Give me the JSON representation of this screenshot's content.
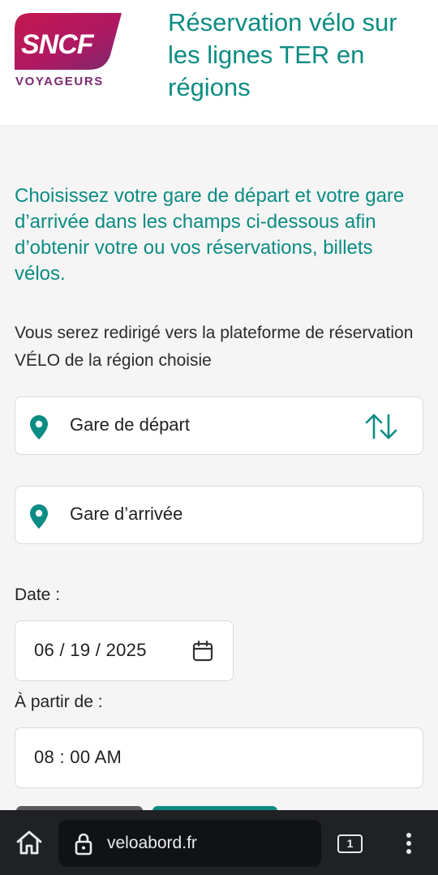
{
  "header": {
    "logo_text": "SNCF",
    "logo_sub": "VOYAGEURS",
    "title": "Réservation vélo sur les lignes TER en régions"
  },
  "main": {
    "intro": "Choisissez votre gare de départ et votre gare d’arrivée dans les champs ci-dessous afin d’obtenir votre ou vos réservations, billets vélos.",
    "note": "Vous serez redirigé vers la plateforme de réservation VÉLO de la région choisie",
    "departure": {
      "placeholder": "Gare de départ",
      "icon": "location-pin-icon"
    },
    "arrival": {
      "placeholder": "Gare d’arrivée",
      "icon": "location-pin-icon"
    },
    "swap_icon": "swap-arrows-icon",
    "date_label": "Date :",
    "date_value": "06 / 19 / 2025",
    "time_label": "À partir de :",
    "time_value": "08 : 00   AM"
  },
  "browser": {
    "url": "veloabord.fr",
    "tab_count": "1",
    "icons": [
      "home-icon",
      "lock-icon",
      "tabs-icon",
      "menu-icon"
    ]
  },
  "colors": {
    "accent": "#0c8c83",
    "logo_gradient_start": "#c4174f",
    "logo_gradient_end": "#7a2a6e",
    "browser_bar": "#202124"
  }
}
